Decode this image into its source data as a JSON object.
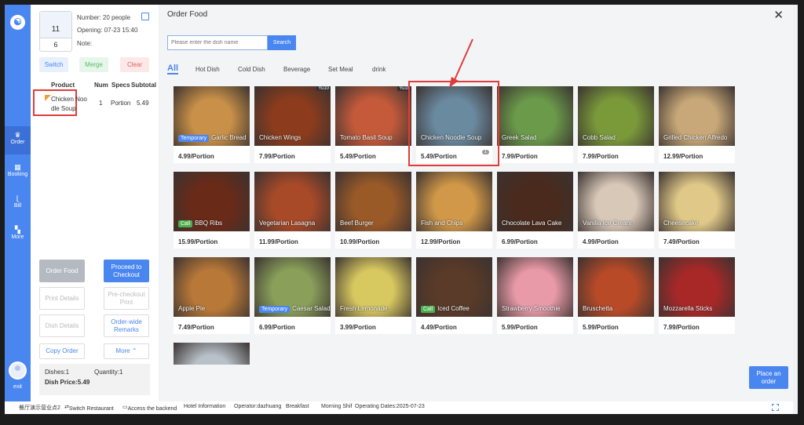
{
  "rail": {
    "items": [
      {
        "label": "Order",
        "icon": "crown-icon"
      },
      {
        "label": "Booking",
        "icon": "calendar-icon"
      },
      {
        "label": "Bill",
        "icon": "chart-icon"
      },
      {
        "label": "More",
        "icon": "grid-icon"
      }
    ],
    "exit_label": "exit"
  },
  "table": {
    "number": "11",
    "guests": "6",
    "number_people": "Number: 20 people",
    "opening": "Opening: 07-23 15:40",
    "note": "Note:"
  },
  "actions": {
    "switch": "Switch",
    "merge": "Merge",
    "clear": "Clear"
  },
  "order_table": {
    "headers": [
      "Product",
      "Num",
      "Specs",
      "Subtotal"
    ],
    "rows": [
      {
        "product_line1": "Chicken Noo",
        "product_line2": "dle Soup",
        "num": "1",
        "specs": "Portion",
        "subtotal": "5.49"
      }
    ]
  },
  "left_buttons": {
    "order_food": "Order Food",
    "checkout_line1": "Proceed to",
    "checkout_line2": "Checkout",
    "print_details": "Print Details",
    "precheckout_line1": "Pre-checkout",
    "precheckout_line2": "Print",
    "dish_details": "Dish Details",
    "orderwide_line1": "Order-wide",
    "orderwide_line2": "Remarks",
    "copy_order": "Copy Order",
    "more": "More"
  },
  "summary": {
    "dishes": "Dishes:1",
    "quantity": "Quantity:1",
    "price": "Dish Price:5.49"
  },
  "main": {
    "title": "Order Food",
    "search_placeholder": "Please enter the dish name",
    "search_button": "Search",
    "tabs": [
      "All",
      "Hot Dish",
      "Cold Dish",
      "Beverage",
      "Set Meal",
      "drink"
    ],
    "place_line1": "Place an",
    "place_line2": "order"
  },
  "dishes": [
    {
      "name": "Garlic Bread",
      "price": "4.99/Portion",
      "tag": "Temporary",
      "color": "#c89048"
    },
    {
      "name": "Chicken Wings",
      "price": "7.99/Portion",
      "corner": "Yu10",
      "color": "#8c3c1c"
    },
    {
      "name": "Tomato Basil Soup",
      "price": "5.49/Portion",
      "corner": "Yu10",
      "color": "#c45a3a"
    },
    {
      "name": "Chicken Noodle Soup",
      "price": "5.49/Portion",
      "badge": "1",
      "color": "#6a8aa0"
    },
    {
      "name": "Greek Salad",
      "price": "7.99/Portion",
      "color": "#6a9a4a"
    },
    {
      "name": "Cobb Salad",
      "price": "7.99/Portion",
      "color": "#7a9a3a"
    },
    {
      "name": "Grilled Chicken Alfredo",
      "price": "12.99/Portion",
      "color": "#c8a878"
    },
    {
      "name": "BBQ Ribs",
      "price": "15.99/Portion",
      "tag": "Call",
      "color": "#6a2a18"
    },
    {
      "name": "Vegetarian Lasagna",
      "price": "11.99/Portion",
      "color": "#a84a28"
    },
    {
      "name": "Beef Burger",
      "price": "10.99/Portion",
      "color": "#9a5a28"
    },
    {
      "name": "Fish and Chips",
      "price": "12.99/Portion",
      "color": "#d09848"
    },
    {
      "name": "Chocolate Lava Cake",
      "price": "6.99/Portion",
      "color": "#4a2a1c"
    },
    {
      "name": "Vanilla Ice Cream",
      "price": "4.99/Portion",
      "color": "#d8c8b8"
    },
    {
      "name": "Cheesecake",
      "price": "7.49/Portion",
      "color": "#e0c888"
    },
    {
      "name": "Apple Pie",
      "price": "7.49/Portion",
      "color": "#b87838"
    },
    {
      "name": "Caesar Salad",
      "price": "6.99/Portion",
      "tag": "Temporary",
      "color": "#8aa05a"
    },
    {
      "name": "Fresh Lemonade",
      "price": "3.99/Portion",
      "color": "#d8c860"
    },
    {
      "name": "Iced Coffee",
      "price": "4.49/Portion",
      "tag": "Call",
      "color": "#5a3a28"
    },
    {
      "name": "Strawberry Smoothie",
      "price": "5.99/Portion",
      "color": "#e89aa8"
    },
    {
      "name": "Bruschetta",
      "price": "5.99/Portion",
      "color": "#b84a28"
    },
    {
      "name": "Mozzarella Sticks",
      "price": "7.99/Portion",
      "color": "#a82828"
    },
    {
      "name": "",
      "price": "",
      "color": "#b8c0c8"
    }
  ],
  "status_bar": {
    "restaurant": "餐厅演示营业点2",
    "switch_restaurant": "Switch Restaurant",
    "access_backend": "Access the backend",
    "hotel_info": "Hotel Information",
    "operator": "Operator:dazhuang",
    "meal": "Breakfast",
    "shift": "Morning Shif",
    "dates": "Operating Dates:2025-07-23"
  },
  "colors": {
    "accent": "#4a86f0",
    "highlight": "#e03c3c"
  }
}
